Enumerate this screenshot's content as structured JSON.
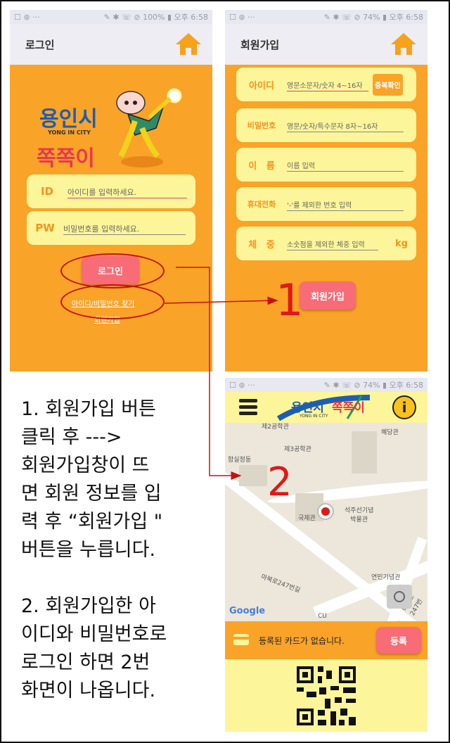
{
  "login_screen": {
    "status_left": "☐ ⊛ ···",
    "status_right": "✎ ✱ ☏ ⊘ 100% ▮ 오후 6:58",
    "title": "로그인",
    "logo_title": "용인시",
    "logo_sub": "YONG IN CITY",
    "logo_brand": "쪽쪽이",
    "id_label": "ID",
    "id_placeholder": "아이디를 입력하세요.",
    "pw_label": "PW",
    "pw_placeholder": "비밀번호를 입력하세요.",
    "login_button": "로그인",
    "find_link": "아이디/비밀번호 찾기",
    "signup_link": "회원가입"
  },
  "signup_screen": {
    "status_left": "☐ ⊛ ···",
    "status_right": "✎ ✱ ☏ ⊘ 74% ▮ 오후 6:58",
    "title": "회원가입",
    "fields": [
      {
        "label": "아이디",
        "placeholder": "영문소문자/숫자 4~16자",
        "button": "중복확인"
      },
      {
        "label": "비밀번호",
        "placeholder": "영문/숫자/특수문자 8자~16자"
      },
      {
        "label": "이   름",
        "placeholder": "이름 입력"
      },
      {
        "label": "휴대전화",
        "placeholder": "'-'를 제외한 번호 입력"
      },
      {
        "label": "체   중",
        "placeholder": "소숫점을 제외한 체중 입력",
        "unit": "kg"
      }
    ],
    "signup_button": "회원가입"
  },
  "map_screen": {
    "status_left": "☐ ⊛ ···",
    "status_right": "✎ ✱ ☏ ⊘ 74% ▮ 오후 6:58",
    "logo_title": "용인시",
    "logo_brand": "쪽쪽이",
    "logo_sub": "YONG IN CITY",
    "pois": [
      "제2공학관",
      "혜당관",
      "제3공학관",
      "함실정동",
      "석주선기념\n박물관",
      "국제관",
      "연민기념관",
      "마북로247번길",
      "마북로247번",
      "CU"
    ],
    "google": "Google",
    "card_text": "등록된 카드가 없습니다.",
    "register_button": "등록"
  },
  "annotations": {
    "step1": "1",
    "step2": "2",
    "instructions": "1. 회원가입 버튼\n클릭 후 --->\n 회원가입창이 뜨\n면 회원 정보를 입\n력 후 “회원가입 \"\n버튼을 누릅니다.\n\n2. 회원가입한 아\n이디와 비밀번호로\n로그인 하면 2번\n화면이 나옵니다."
  }
}
